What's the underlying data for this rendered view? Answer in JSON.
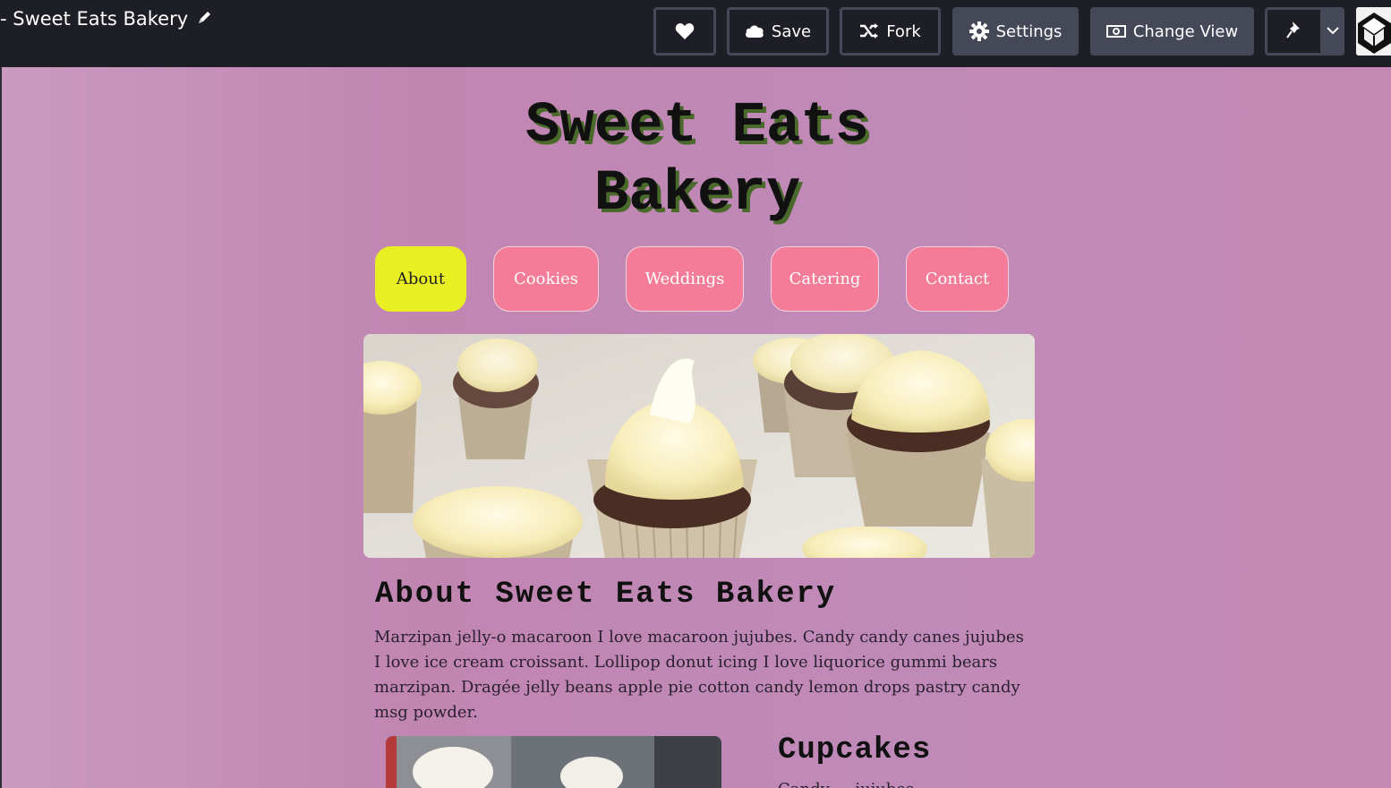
{
  "toolbar": {
    "title": "- Sweet Eats Bakery",
    "buttons": {
      "save": "Save",
      "fork": "Fork",
      "settings": "Settings",
      "change_view": "Change View"
    },
    "icons": [
      "edit-pencil-icon",
      "heart-icon",
      "cloud-icon",
      "fork-icon",
      "gear-icon",
      "view-icon",
      "pin-icon",
      "chevron-down-icon",
      "user-avatar"
    ]
  },
  "site": {
    "title_line1": "Sweet Eats",
    "title_line2": "Bakery",
    "nav": [
      {
        "label": "About",
        "active": true
      },
      {
        "label": "Cookies",
        "active": false
      },
      {
        "label": "Weddings",
        "active": false
      },
      {
        "label": "Catering",
        "active": false
      },
      {
        "label": "Contact",
        "active": false
      }
    ],
    "hero_image": "cupcakes-photo",
    "about_heading": "About Sweet Eats Bakery",
    "about_text": "Marzipan jelly-o macaroon I love macaroon jujubes. Candy candy canes jujubes I love ice cream croissant. Lollipop donut icing I love liquorice gummi bears marzipan. Dragée jelly beans apple pie cotton candy lemon drops pastry candy msg powder.",
    "cupcakes_heading": "Cupcakes",
    "cupcakes_subtext": "Candy ... jujubes"
  },
  "colors": {
    "toolbar_bg": "#1e1f26",
    "button_border": "#444857",
    "nav_active": "#e9ef23",
    "nav_default": "#f47c98",
    "page_bg": "#c185b2",
    "title_shadow": "#4a6a2c"
  }
}
